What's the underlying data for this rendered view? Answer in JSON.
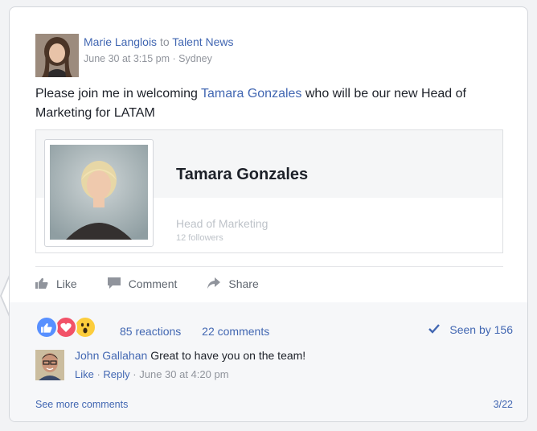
{
  "post": {
    "author": "Marie Langlois",
    "to_word": "to",
    "group": "Talent News",
    "time": "June 30 at 3:15 pm",
    "dot": "·",
    "location": "Sydney",
    "text_before": "Please join me in welcoming ",
    "mention": "Tamara Gonzales",
    "text_after": " who will be our new Head of Marketing for LATAM"
  },
  "profile_card": {
    "name": "Tamara Gonzales",
    "title": "Head of Marketing",
    "followers": "12 followers"
  },
  "actions": {
    "like": "Like",
    "comment": "Comment",
    "share": "Share"
  },
  "stats": {
    "reactions": "85 reactions",
    "comments": "22 comments",
    "seen": "Seen by 156"
  },
  "comment": {
    "author": "John Gallahan",
    "text": "Great to have you on the team!",
    "like": "Like",
    "reply": "Reply",
    "time": "June 30 at 4:20 pm"
  },
  "footer": {
    "see_more": "See more comments",
    "pager": "3/22"
  },
  "colors": {
    "link": "#4267b2",
    "like_blue": "#5890ff",
    "love_red": "#f25268",
    "wow_yellow": "#fccd3c"
  }
}
